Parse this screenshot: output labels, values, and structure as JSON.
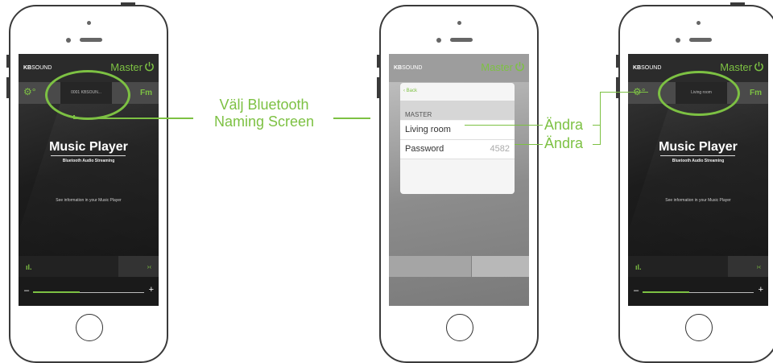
{
  "phones": {
    "left": {
      "brand_bold": "KB",
      "brand_rest": "SOUND",
      "master": "Master",
      "device_name": "0001 KBSOUN...",
      "fm": "Fm",
      "title": "Music Player",
      "subtitle": "Bluetooth Audio Streaming",
      "info": "See information in your Music Player",
      "volume_minus": "–",
      "volume_plus": "+",
      "volume_level": 0.42
    },
    "middle": {
      "brand_bold": "KB",
      "brand_rest": "SOUND",
      "master": "Master",
      "back": "Back",
      "section": "MASTER",
      "rows": [
        {
          "label": "Living room",
          "value": ""
        },
        {
          "label": "Password",
          "value": "4582"
        }
      ]
    },
    "right": {
      "brand_bold": "KB",
      "brand_rest": "SOUND",
      "master": "Master",
      "device_name": "Living room",
      "fm": "Fm",
      "title": "Music Player",
      "subtitle": "Bluetooth Audio Streaming",
      "info": "See information in your Music Player",
      "volume_minus": "–",
      "volume_plus": "+",
      "volume_level": 0.42
    }
  },
  "annotations": {
    "naming_screen_line1": "Välj Bluetooth",
    "naming_screen_line2": "Naming Screen",
    "edit_1": "Ändra",
    "edit_2": "Ändra"
  },
  "colors": {
    "accent": "#7dc143",
    "dark_screen": "#1c1c1c"
  },
  "icons": [
    "power-icon",
    "gear-icon",
    "equalizer-icon",
    "connect-icon",
    "chevron-left-icon"
  ]
}
